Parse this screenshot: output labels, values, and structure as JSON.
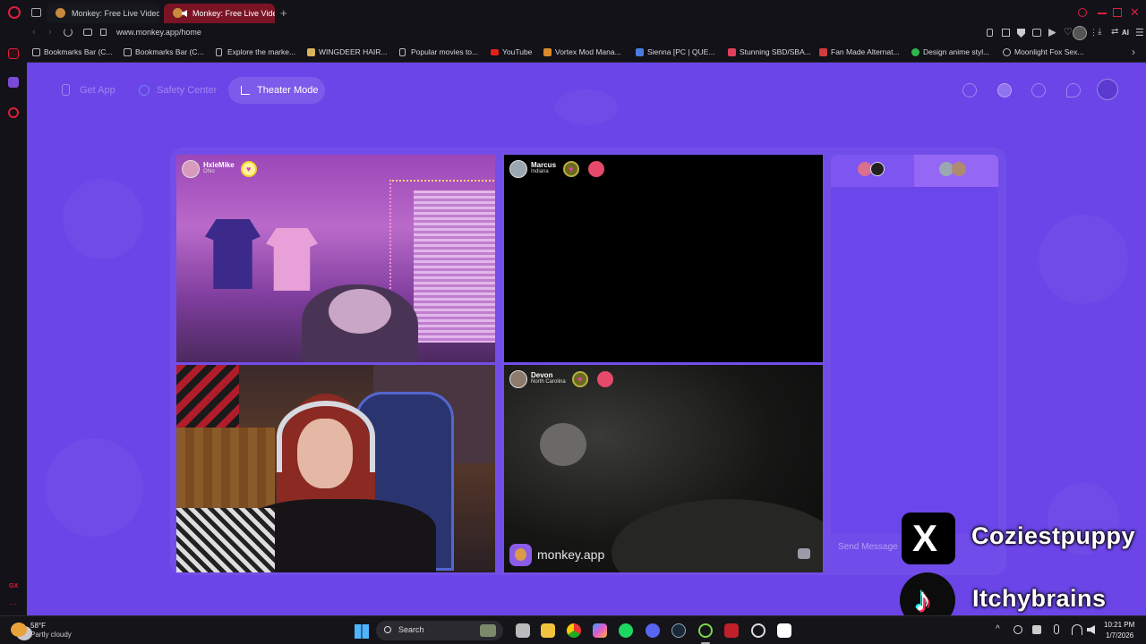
{
  "browser": {
    "tabs": [
      {
        "label": "Monkey: Free Live Video C",
        "active": false
      },
      {
        "label": "Monkey: Free Live Vide",
        "active": true
      }
    ],
    "url": "www.monkey.app/home",
    "ai_label": "AI",
    "bookmarks": [
      "Bookmarks Bar (C...",
      "Bookmarks Bar (C...",
      "Explore the marke...",
      "WINGDEER HAIR...",
      "Popular movies to...",
      "YouTube",
      "Vortex Mod Mana...",
      "Sienna [PC | QUE...",
      "Stunning SBD/SBA...",
      "Fan Made Alternat...",
      "Design anime styl...",
      "Moonlight Fox Sex..."
    ],
    "sidebar_bottom_label": "GX"
  },
  "nav": {
    "get_app": "Get App",
    "safety_center": "Safety Center",
    "theater_mode": "Theater Mode"
  },
  "videos": [
    {
      "name": "HxleMike",
      "location": "Ohio"
    },
    {
      "name": "Marcus",
      "location": "Indiana"
    },
    {
      "name": "",
      "location": ""
    },
    {
      "name": "Devon",
      "location": "North Carolina"
    }
  ],
  "watermark": "monkey.app",
  "chat": {
    "placeholder": "Send Message"
  },
  "overlay": {
    "x_handle": "Coziestpuppy",
    "tiktok_handle": "Itchybrains"
  },
  "taskbar": {
    "temperature": "58°F",
    "weather": "Partly cloudy",
    "search": "Search",
    "time": "10:21 PM",
    "date": "1/7/2026"
  },
  "colors": {
    "page_bg": "#6b45e8",
    "accent_red": "#e01e3c",
    "video_dark": "#000000"
  }
}
